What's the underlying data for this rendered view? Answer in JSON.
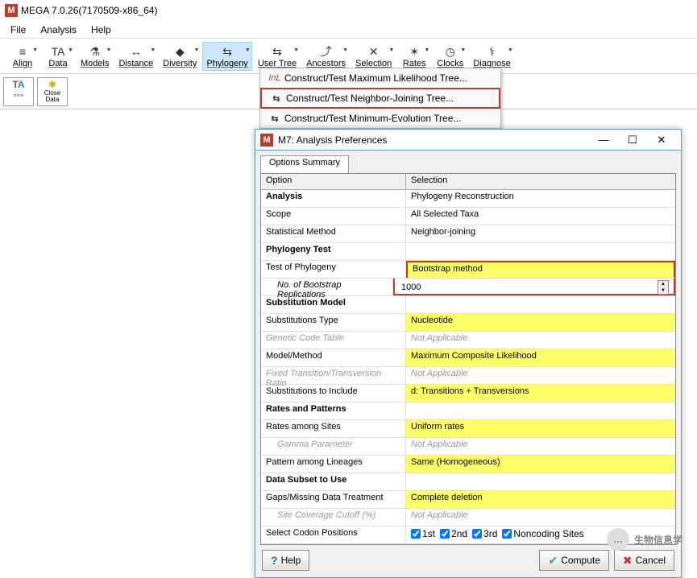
{
  "window": {
    "title": "MEGA 7.0.26(7170509-x86_64)"
  },
  "menu": [
    "File",
    "Analysis",
    "Help"
  ],
  "toolbar": [
    {
      "icon": "≡",
      "label": "Align"
    },
    {
      "icon": "TA",
      "label": "Data"
    },
    {
      "icon": "⚗",
      "label": "Models"
    },
    {
      "icon": "↔",
      "label": "Distance"
    },
    {
      "icon": "◆",
      "label": "Diversity"
    },
    {
      "icon": "⇆",
      "label": "Phylogeny",
      "active": true
    },
    {
      "icon": "⇆",
      "label": "User Tree"
    },
    {
      "icon": "⤴",
      "label": "Ancestors"
    },
    {
      "icon": "✕",
      "label": "Selection"
    },
    {
      "icon": "✶",
      "label": "Rates"
    },
    {
      "icon": "◷",
      "label": "Clocks"
    },
    {
      "icon": "⚕",
      "label": "Diagnose"
    }
  ],
  "secondary": [
    {
      "icon": "TA",
      "label": ""
    },
    {
      "icon": "✱",
      "label": "Close Data"
    }
  ],
  "dropdown": [
    {
      "icon": "InL",
      "label": "Construct/Test Maximum Likelihood Tree..."
    },
    {
      "icon": "⇆",
      "label": "Construct/Test Neighbor-Joining Tree...",
      "highlight": true
    },
    {
      "icon": "⇆",
      "label": "Construct/Test Minimum-Evolution Tree..."
    }
  ],
  "dialog": {
    "title": "M7: Analysis Preferences",
    "tab": "Options Summary",
    "headers": {
      "opt": "Option",
      "sel": "Selection"
    },
    "rows": [
      {
        "c1": "Analysis",
        "c2": "Phylogeny Reconstruction",
        "section": true
      },
      {
        "c1": "Scope",
        "c2": "All Selected Taxa"
      },
      {
        "c1": "Statistical Method",
        "c2": "Neighbor-joining"
      },
      {
        "c1": "Phylogeny Test",
        "c2": "",
        "section": true
      },
      {
        "c1": "Test of Phylogeny",
        "c2": "Bootstrap method",
        "hl": true,
        "red": true
      },
      {
        "c1": "No. of Bootstrap Replications",
        "c2": "1000",
        "indent": true,
        "red": true,
        "spinner": true,
        "italic": true
      },
      {
        "c1": "Substitution Model",
        "c2": "",
        "section": true
      },
      {
        "c1": "Substitutions Type",
        "c2": "Nucleotide",
        "hl": true
      },
      {
        "c1": "Genetic Code Table",
        "c2": "Not Applicable",
        "disabled": true
      },
      {
        "c1": "Model/Method",
        "c2": "Maximum Composite Likelihood",
        "hl": true
      },
      {
        "c1": "Fixed Transition/Transversion Ratio",
        "c2": "Not Applicable",
        "disabled": true
      },
      {
        "c1": "Substitutions to Include",
        "c2": "d: Transitions + Transversions",
        "hl": true
      },
      {
        "c1": "Rates and Patterns",
        "c2": "",
        "section": true
      },
      {
        "c1": "Rates among Sites",
        "c2": "Uniform rates",
        "hl": true
      },
      {
        "c1": "Gamma Parameter",
        "c2": "Not Applicable",
        "indent": true,
        "disabled": true
      },
      {
        "c1": "Pattern among Lineages",
        "c2": "Same (Homogeneous)",
        "hl": true
      },
      {
        "c1": "Data Subset to Use",
        "c2": "",
        "section": true
      },
      {
        "c1": "Gaps/Missing Data Treatment",
        "c2": "Complete deletion",
        "hl": true
      },
      {
        "c1": "Site Coverage Cutoff (%)",
        "c2": "Not Applicable",
        "indent": true,
        "disabled": true
      },
      {
        "c1": "Select Codon Positions",
        "c2": "",
        "codon": true
      }
    ],
    "codon": [
      "1st",
      "2nd",
      "3rd",
      "Noncoding Sites"
    ],
    "buttons": {
      "help": "Help",
      "compute": "Compute",
      "cancel": "Cancel"
    }
  },
  "watermark": "生物信息学"
}
